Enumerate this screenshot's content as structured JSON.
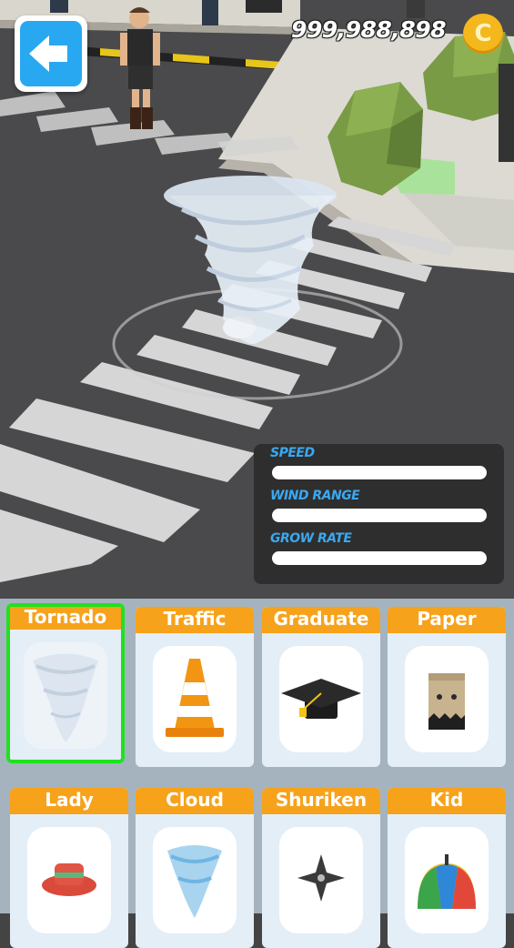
{
  "hud": {
    "coin_count": "999,988,898",
    "coin_symbol": "C",
    "back_icon": "left-arrow-icon"
  },
  "stats": {
    "speed": {
      "label": "SPEED",
      "level": 0.0
    },
    "wind_range": {
      "label": "WIND RANGE",
      "level": 0.0
    },
    "grow_rate": {
      "label": "GROW RATE",
      "level": 0.0
    }
  },
  "skins": [
    {
      "label": "Tornado",
      "icon": "tornado-icon",
      "selected": true
    },
    {
      "label": "Traffic",
      "icon": "traffic-cone-icon",
      "selected": false
    },
    {
      "label": "Graduate",
      "icon": "graduation-cap-icon",
      "selected": false
    },
    {
      "label": "Paper",
      "icon": "paper-bag-icon",
      "selected": false
    },
    {
      "label": "Lady",
      "icon": "lady-hat-icon",
      "selected": false
    },
    {
      "label": "Cloud",
      "icon": "cloud-tornado-icon",
      "selected": false
    },
    {
      "label": "Shuriken",
      "icon": "shuriken-icon",
      "selected": false
    },
    {
      "label": "Kid",
      "icon": "propeller-hat-icon",
      "selected": false
    }
  ],
  "colors": {
    "accent_blue": "#3aa8f0",
    "card_header": "#f7a21b",
    "selected_border": "#1fe21f",
    "coin": "#f4b71c"
  }
}
